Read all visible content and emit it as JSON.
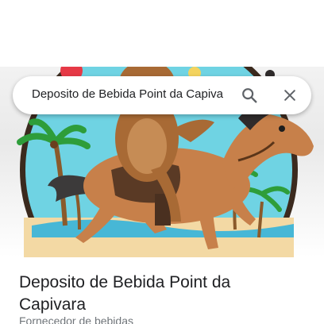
{
  "search": {
    "query": "Deposito de Bebida Point da Capiva"
  },
  "place": {
    "title": "Deposito de Bebida Point da Capivara",
    "category": "Fornecedor de bebidas"
  },
  "icons": {
    "search": "search-icon",
    "close": "close-icon"
  },
  "colors": {
    "text_primary": "#202124",
    "text_secondary": "#70757a",
    "icon": "#5f6368"
  }
}
